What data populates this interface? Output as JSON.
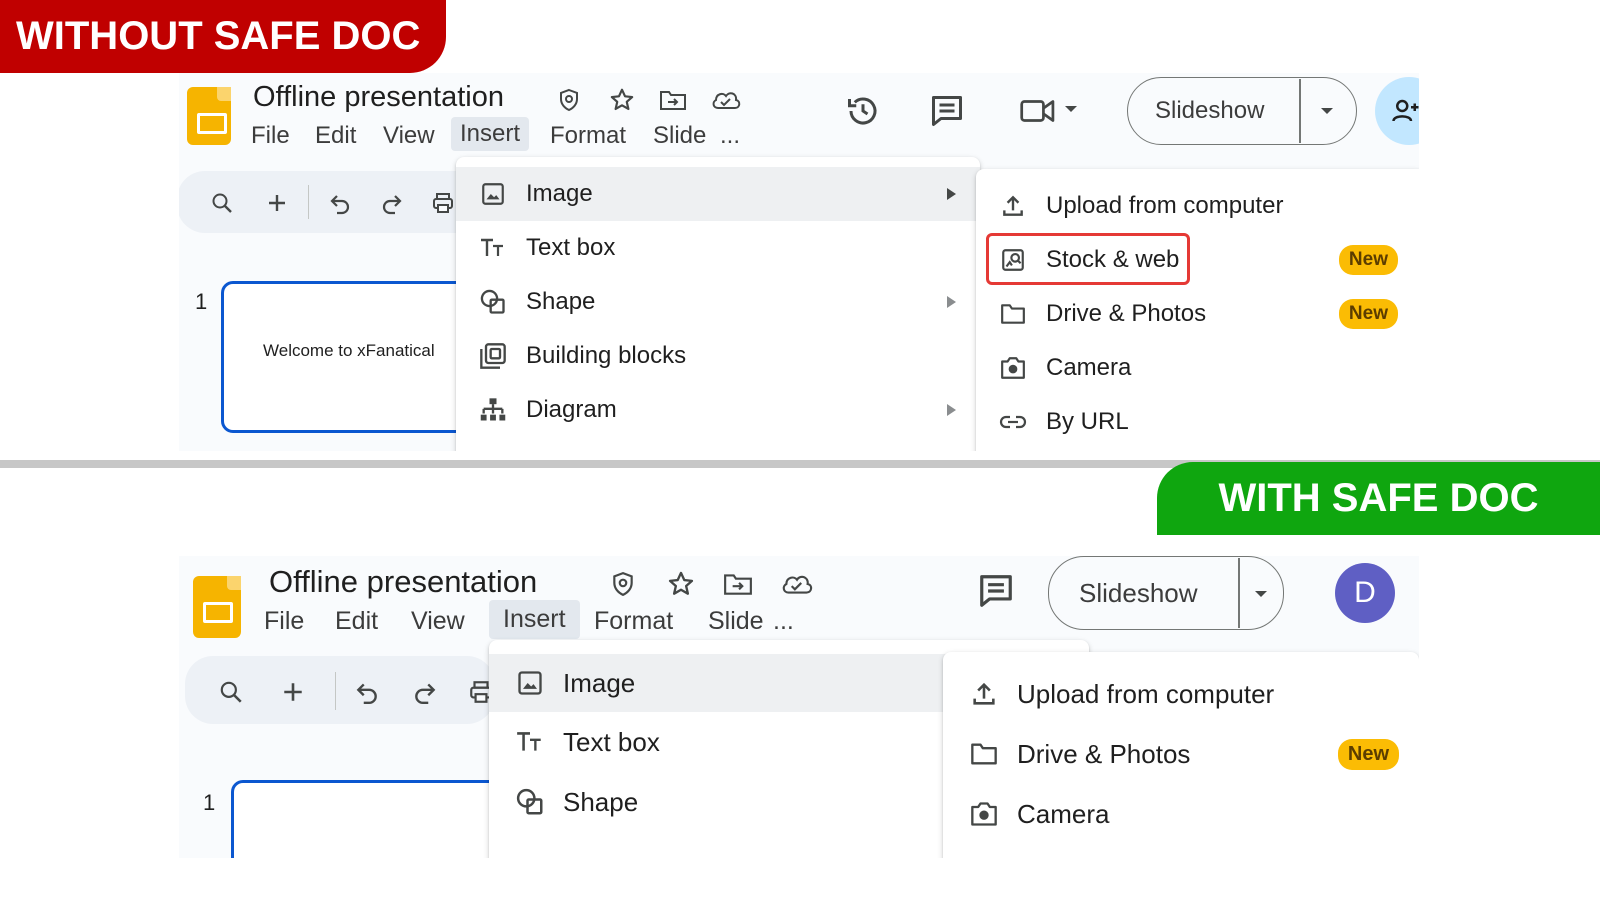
{
  "labels": {
    "without": "WITHOUT SAFE DOC",
    "with": "WITH SAFE DOC"
  },
  "colors": {
    "without_tag": "#c00000",
    "with_tag": "#0fa60f",
    "app_logo": "#f6b400",
    "new_badge": "#fbbc04",
    "highlight": "#e53935",
    "avatar_bg": "#5f5fc4"
  },
  "top": {
    "doc_title": "Offline presentation",
    "menu": [
      "File",
      "Edit",
      "View",
      "Insert",
      "Format",
      "Slide",
      "..."
    ],
    "slideshow_label": "Slideshow",
    "slide_number": "1",
    "slide_text": "Welcome to xFanatical",
    "insert_menu": [
      {
        "label": "Image",
        "icon": "image-icon",
        "submenu": true
      },
      {
        "label": "Text box",
        "icon": "text-box-icon",
        "submenu": false
      },
      {
        "label": "Shape",
        "icon": "shape-icon",
        "submenu": true
      },
      {
        "label": "Building blocks",
        "icon": "building-blocks-icon",
        "submenu": false
      },
      {
        "label": "Diagram",
        "icon": "diagram-icon",
        "submenu": true
      }
    ],
    "image_submenu": [
      {
        "label": "Upload from computer",
        "icon": "upload-icon",
        "badge": ""
      },
      {
        "label": "Stock & web",
        "icon": "stock-web-icon",
        "badge": "New"
      },
      {
        "label": "Drive & Photos",
        "icon": "folder-icon",
        "badge": "New"
      },
      {
        "label": "Camera",
        "icon": "camera-icon",
        "badge": ""
      },
      {
        "label": "By URL",
        "icon": "link-icon",
        "badge": ""
      }
    ]
  },
  "bottom": {
    "doc_title": "Offline presentation",
    "menu": [
      "File",
      "Edit",
      "View",
      "Insert",
      "Format",
      "Slide",
      "..."
    ],
    "slideshow_label": "Slideshow",
    "avatar_letter": "D",
    "slide_number": "1",
    "insert_menu": [
      {
        "label": "Image",
        "icon": "image-icon"
      },
      {
        "label": "Text box",
        "icon": "text-box-icon"
      },
      {
        "label": "Shape",
        "icon": "shape-icon"
      }
    ],
    "image_submenu": [
      {
        "label": "Upload from computer",
        "icon": "upload-icon",
        "badge": ""
      },
      {
        "label": "Drive & Photos",
        "icon": "folder-icon",
        "badge": "New"
      },
      {
        "label": "Camera",
        "icon": "camera-icon",
        "badge": ""
      }
    ]
  }
}
